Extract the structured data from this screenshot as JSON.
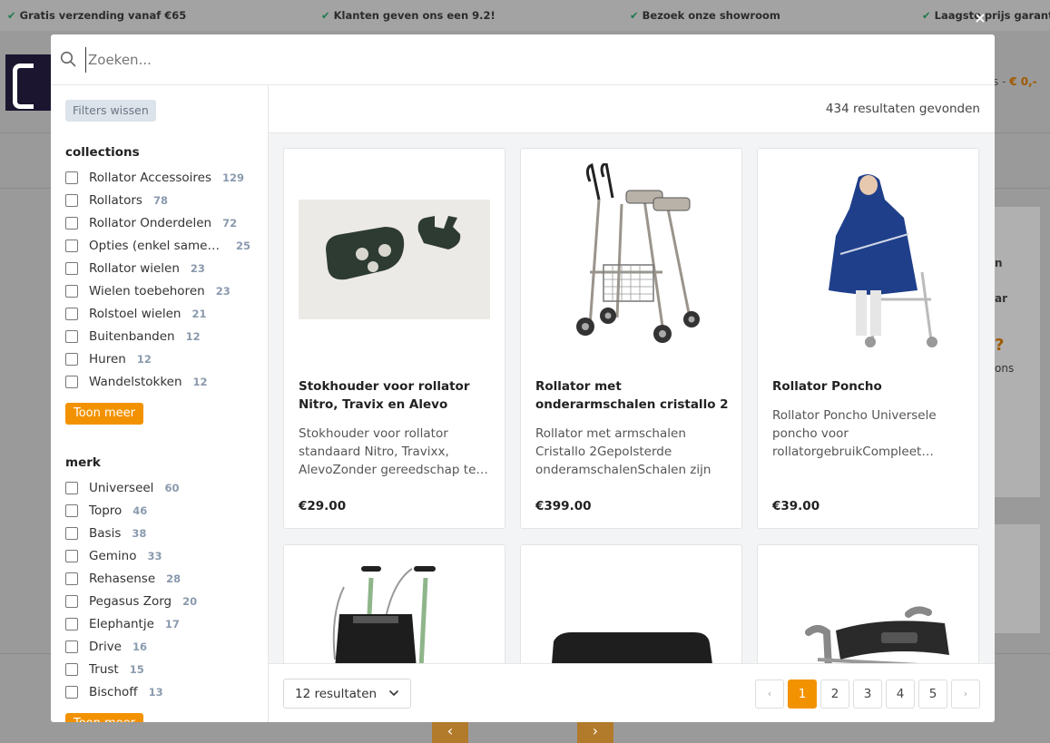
{
  "background": {
    "usps": [
      "Gratis verzending vanaf €65",
      "Klanten geven ons een 9.2!",
      "Bezoek onze showroom",
      "Laagste prijs garantie"
    ],
    "cart_label": "s - ",
    "cart_amount": "€ 0,-",
    "side_text_1": "n",
    "side_text_2": "ar",
    "side_text_3": "?",
    "side_text_4": "ons",
    "prev_arrow": "‹",
    "next_arrow": "›"
  },
  "modal": {
    "close_icon": "×",
    "search": {
      "placeholder": "Zoeken...",
      "value": ""
    },
    "clear_filters_label": "Filters wissen",
    "facets": [
      {
        "title": "collections",
        "items": [
          {
            "label": "Rollator Accessoires",
            "count": "129"
          },
          {
            "label": "Rollators",
            "count": "78"
          },
          {
            "label": "Rollator Onderdelen",
            "count": "72"
          },
          {
            "label": "Opties (enkel samen ...",
            "count": "25"
          },
          {
            "label": "Rollator wielen",
            "count": "23"
          },
          {
            "label": "Wielen toebehoren",
            "count": "23"
          },
          {
            "label": "Rolstoel wielen",
            "count": "21"
          },
          {
            "label": "Buitenbanden",
            "count": "12"
          },
          {
            "label": "Huren",
            "count": "12"
          },
          {
            "label": "Wandelstokken",
            "count": "12"
          }
        ],
        "show_more_label": "Toon meer"
      },
      {
        "title": "merk",
        "items": [
          {
            "label": "Universeel",
            "count": "60"
          },
          {
            "label": "Topro",
            "count": "46"
          },
          {
            "label": "Basis",
            "count": "38"
          },
          {
            "label": "Gemino",
            "count": "33"
          },
          {
            "label": "Rehasense",
            "count": "28"
          },
          {
            "label": "Pegasus Zorg",
            "count": "20"
          },
          {
            "label": "Elephantje",
            "count": "17"
          },
          {
            "label": "Drive",
            "count": "16"
          },
          {
            "label": "Trust",
            "count": "15"
          },
          {
            "label": "Bischoff",
            "count": "13"
          }
        ],
        "show_more_label": "Toon meer"
      }
    ],
    "results_count": "434 resultaten gevonden",
    "products": [
      {
        "title": "Stokhouder voor rollator Nitro, Travix en Alevo",
        "description": "Stokhouder voor rollator standaard Nitro, Travixx, AlevoZonder gereedschap te…",
        "price": "€29.00",
        "image_icon": "cane-holder-image"
      },
      {
        "title": "Rollator met onderarmschalen cristallo 2",
        "description": "Rollator met armschalen Cristallo 2Gepolsterde onderamschalenSchalen zijn in…",
        "price": "€399.00",
        "image_icon": "forearm-rollator-image"
      },
      {
        "title": "Rollator Poncho",
        "description": "Rollator Poncho Universele poncho voor rollatorgebruikCompleet…",
        "price": "€39.00",
        "image_icon": "rollator-poncho-image"
      },
      {
        "image_icon": "rollator-bag-image"
      },
      {
        "image_icon": "seat-cushion-image"
      },
      {
        "image_icon": "back-belt-image"
      }
    ],
    "per_page_label": "12 resultaten",
    "pagination": {
      "prev": "‹",
      "pages": [
        "1",
        "2",
        "3",
        "4",
        "5"
      ],
      "current": "1",
      "next": "›"
    },
    "colors": {
      "accent": "#f39200",
      "count": "#8a9aae"
    }
  }
}
